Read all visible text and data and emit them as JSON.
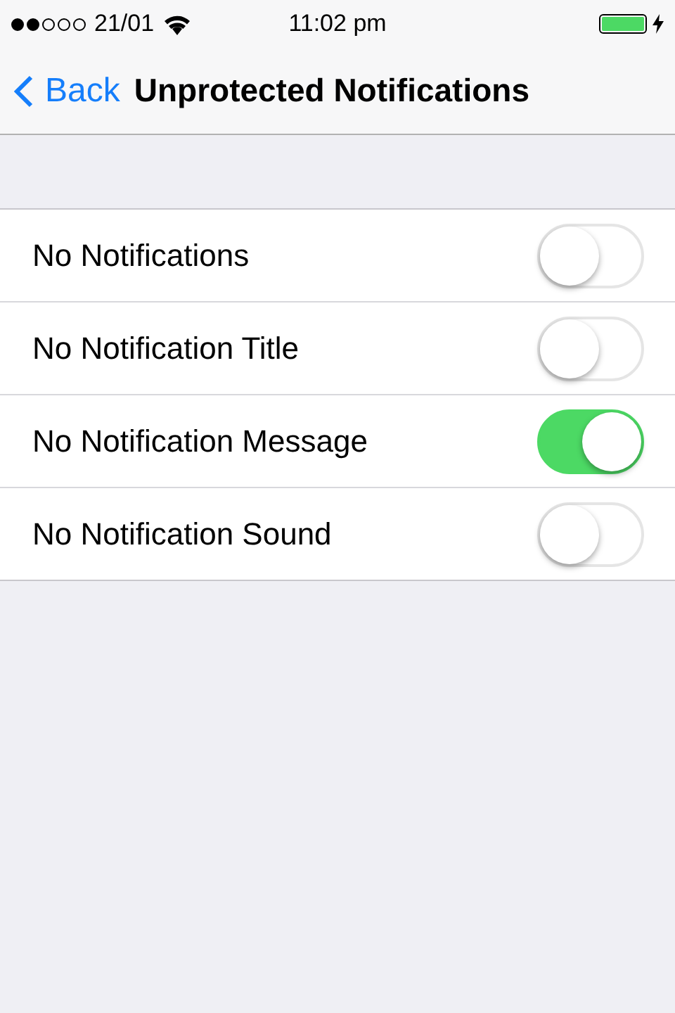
{
  "status_bar": {
    "carrier": "21/01",
    "time": "11:02 pm"
  },
  "nav_bar": {
    "back": "Back",
    "title": "Unprotected Notifications"
  },
  "settings": [
    {
      "label": "No Notifications",
      "on": false
    },
    {
      "label": "No Notification Title",
      "on": false
    },
    {
      "label": "No Notification Message",
      "on": true
    },
    {
      "label": "No Notification Sound",
      "on": false
    }
  ]
}
